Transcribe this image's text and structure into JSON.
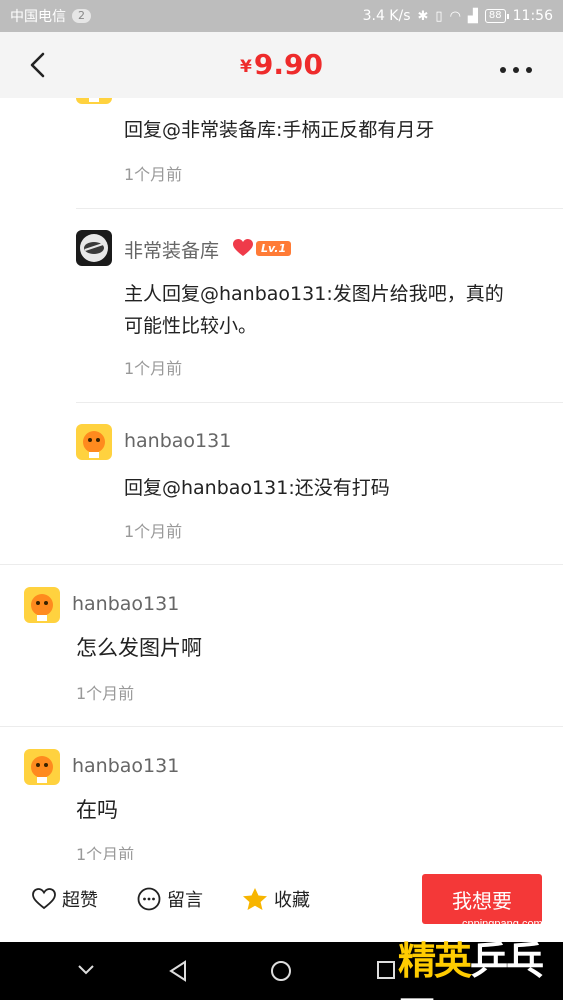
{
  "status_bar": {
    "carrier": "中国电信",
    "sim_badge": "2",
    "net_speed": "3.4 K/s",
    "battery": "88",
    "time": "11:56"
  },
  "header": {
    "currency": "¥",
    "price": "9.90"
  },
  "thread": {
    "reply_1": {
      "text": "回复@非常装备库:手柄正反都有月牙",
      "time": "1个月前"
    },
    "reply_2": {
      "user": "非常装备库",
      "level": "Lv.1",
      "text_line1": "主人回复@hanbao131:发图片给我吧，真的",
      "text_line2": "可能性比较小。",
      "time": "1个月前"
    },
    "reply_3": {
      "user": "hanbao131",
      "text": "回复@hanbao131:还没有打码",
      "time": "1个月前"
    }
  },
  "comments": [
    {
      "user": "hanbao131",
      "text": "怎么发图片啊",
      "time": "1个月前"
    },
    {
      "user": "hanbao131",
      "text": "在吗",
      "time": "1个月前"
    }
  ],
  "actions": {
    "like": "超赞",
    "message": "留言",
    "favorite": "收藏",
    "want": "我想要"
  },
  "watermark": {
    "site": "cnpingpang.com",
    "logo_part1": "精英",
    "logo_part2": "乒乓网"
  },
  "colors": {
    "price_red": "#ee2b2b",
    "want_button": "#f43838",
    "star_yellow": "#f7b500",
    "avatar_orange": "#ff9a2e"
  }
}
